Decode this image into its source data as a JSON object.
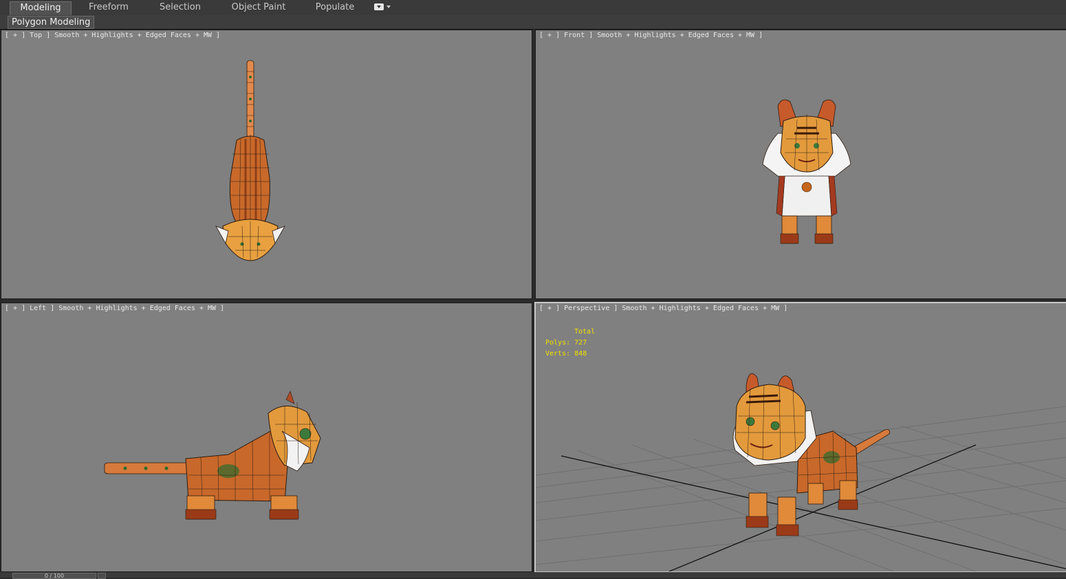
{
  "ribbon": {
    "tabs": [
      {
        "label": "Modeling",
        "active": true
      },
      {
        "label": "Freeform",
        "active": false
      },
      {
        "label": "Selection",
        "active": false
      },
      {
        "label": "Object Paint",
        "active": false
      },
      {
        "label": "Populate",
        "active": false
      }
    ],
    "toggle_icon": "ribbon-minimize-icon",
    "panel_label": "Polygon Modeling"
  },
  "viewports": {
    "top": {
      "label": "[ + ] Top ] Smooth + Highlights + Edged Faces + MW ]"
    },
    "front": {
      "label": "[ + ] Front ] Smooth + Highlights + Edged Faces + MW ]"
    },
    "left": {
      "label": "[ + ] Left ] Smooth + Highlights + Edged Faces + MW ]"
    },
    "perspective": {
      "label": "[ + ] Perspective ] Smooth + Highlights + Edged Faces + MW ]",
      "active": true
    }
  },
  "stats": {
    "total_label": "Total",
    "polys_label": "Polys:",
    "polys_value": "727",
    "verts_label": "Verts:",
    "verts_value": "848",
    "color": "#f2e000"
  },
  "timeline": {
    "position": "0 / 100"
  },
  "colors": {
    "viewport_bg": "#808080",
    "fur_orange": "#d9822b",
    "fur_dark": "#8a3a14",
    "fur_white": "#f2f2f2",
    "wire": "#1a1a1a"
  }
}
